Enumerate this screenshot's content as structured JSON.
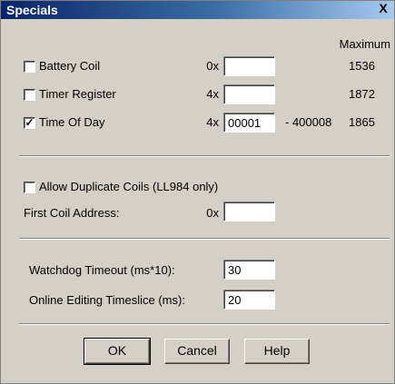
{
  "window": {
    "title": "Specials",
    "close_glyph": "X"
  },
  "header": {
    "maximum_label": "Maximum"
  },
  "rows": [
    {
      "label": "Battery Coil",
      "checked": false,
      "prefix": "0x",
      "value": "",
      "range": "",
      "maximum": "1536"
    },
    {
      "label": "Timer Register",
      "checked": false,
      "prefix": "4x",
      "value": "",
      "range": "",
      "maximum": "1872"
    },
    {
      "label": "Time Of Day",
      "checked": true,
      "prefix": "4x",
      "value": "00001",
      "range": "- 400008",
      "maximum": "1865"
    }
  ],
  "duplicate": {
    "label": "Allow Duplicate Coils (LL984 only)",
    "checked": false
  },
  "first_coil": {
    "label": "First Coil Address:",
    "prefix": "0x",
    "value": ""
  },
  "watchdog": {
    "label": "Watchdog Timeout (ms*10):",
    "value": "30"
  },
  "online": {
    "label": "Online Editing Timeslice (ms):",
    "value": "20"
  },
  "buttons": {
    "ok": "OK",
    "cancel": "Cancel",
    "help": "Help"
  }
}
